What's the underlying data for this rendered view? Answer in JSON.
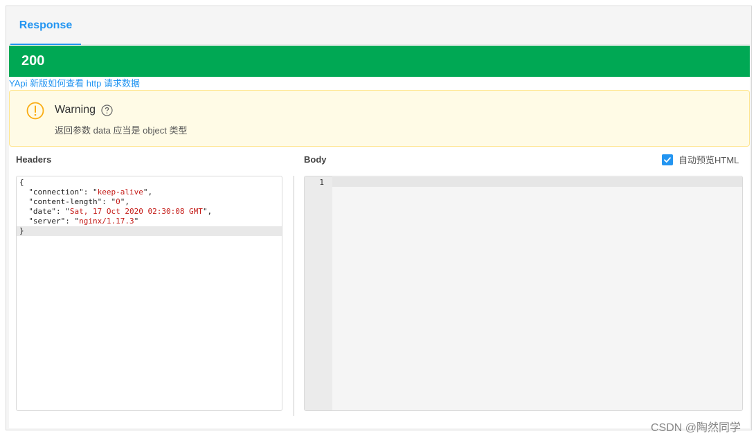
{
  "tabs": [
    {
      "label": "Response"
    }
  ],
  "status": {
    "code": "200",
    "color": "#00a854"
  },
  "help_link": "YApi 新版如何查看 http 请求数据",
  "alert": {
    "title": "Warning",
    "description": "返回参数 data 应当是 object 类型"
  },
  "headers": {
    "label": "Headers",
    "lines": [
      {
        "key": "connection",
        "value": "keep-alive"
      },
      {
        "key": "content-length",
        "value": "0"
      },
      {
        "key": "date",
        "value": "Sat, 17 Oct 2020 02:30:08 GMT"
      },
      {
        "key": "server",
        "value": "nginx/1.17.3"
      }
    ],
    "open": "{",
    "close": "}"
  },
  "body": {
    "label": "Body",
    "line_numbers": [
      "1"
    ]
  },
  "preview": {
    "label": "自动预览HTML",
    "checked": true
  },
  "watermark": "CSDN @陶然同学",
  "colors": {
    "accent": "#2395f1",
    "success": "#00a854",
    "warning_bg": "#fffbe6",
    "warning_icon": "#faad14"
  }
}
